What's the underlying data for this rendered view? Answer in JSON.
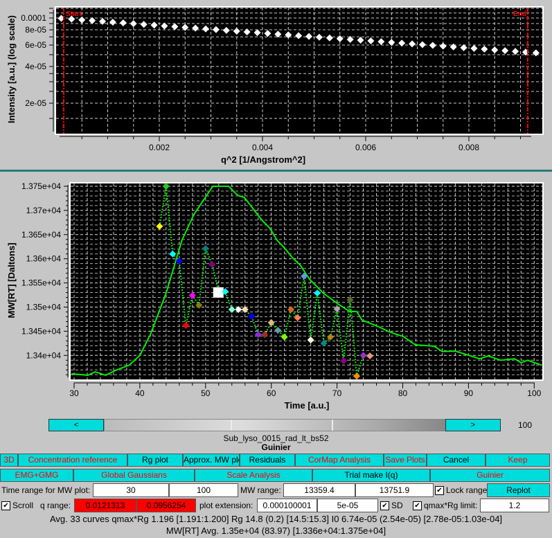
{
  "colors": {
    "button_bg": "#00dcdc",
    "alert_text": "#ff0000",
    "plot_bg": "#000000",
    "grid": "#ffffff",
    "curve": "#00ee00",
    "range_line": "#ff0000"
  },
  "chart_data": [
    {
      "type": "scatter",
      "xlabel": "q^2 [1/Angstrom^2]",
      "ylabel": "Intensity [a.u.] (log scale)",
      "y_scale": "log",
      "grid": true,
      "xlim": [
        0,
        0.00942
      ],
      "ylim": [
        1.12e-05,
        0.000122
      ],
      "x_ticks": [
        "0.002",
        "0.004",
        "0.006",
        "0.008"
      ],
      "x_tick_values": [
        0.002,
        0.004,
        0.006,
        0.008
      ],
      "y_ticks": [
        "0.0001",
        "8e-05",
        "6e-05",
        "4e-05",
        "2e-05"
      ],
      "y_tick_values": [
        0.0001,
        8e-05,
        6e-05,
        4e-05,
        2e-05
      ],
      "markers": [
        {
          "label": "Start",
          "x": 0.000148
        },
        {
          "label": "End",
          "x": 0.00914
        }
      ],
      "x": [
        0.0001,
        0.0003,
        0.0005,
        0.0007,
        0.0009,
        0.0011,
        0.0013,
        0.0015,
        0.0017,
        0.0019,
        0.0021,
        0.0023,
        0.0025,
        0.0027,
        0.0029,
        0.0031,
        0.0033,
        0.0035,
        0.0037,
        0.0039,
        0.0041,
        0.0043,
        0.0045,
        0.0047,
        0.0049,
        0.0051,
        0.0053,
        0.0055,
        0.0057,
        0.0059,
        0.0061,
        0.0063,
        0.0065,
        0.0067,
        0.0069,
        0.0071,
        0.0073,
        0.0075,
        0.0077,
        0.0079,
        0.0081,
        0.0083,
        0.0085,
        0.0087,
        0.0089,
        0.0091,
        0.0093
      ],
      "y": [
        9.93e-05,
        9.79e-05,
        9.65e-05,
        9.52e-05,
        9.38e-05,
        9.25e-05,
        9.12e-05,
        8.99e-05,
        8.86e-05,
        8.74e-05,
        8.61e-05,
        8.49e-05,
        8.37e-05,
        8.26e-05,
        8.14e-05,
        8.03e-05,
        7.91e-05,
        7.8e-05,
        7.69e-05,
        7.58e-05,
        7.47e-05,
        7.37e-05,
        7.27e-05,
        7.16e-05,
        7.06e-05,
        6.96e-05,
        6.87e-05,
        6.77e-05,
        6.67e-05,
        6.58e-05,
        6.49e-05,
        6.4e-05,
        6.31e-05,
        6.22e-05,
        6.13e-05,
        6.04e-05,
        5.96e-05,
        5.88e-05,
        5.79e-05,
        5.71e-05,
        5.63e-05,
        5.55e-05,
        5.47e-05,
        5.4e-05,
        5.32e-05,
        5.25e-05,
        5.17e-05
      ]
    },
    {
      "type": "line",
      "xlabel": "Time [a.u.]",
      "ylabel": "MW[RT] [Daltons]",
      "grid": true,
      "xlim": [
        29.5,
        101.3
      ],
      "ylim": [
        13351,
        13756
      ],
      "x_ticks": [
        "30",
        "40",
        "50",
        "60",
        "70",
        "80",
        "90",
        "100"
      ],
      "x_tick_values": [
        30,
        40,
        50,
        60,
        70,
        80,
        90,
        100
      ],
      "y_ticks": [
        "1.375e+04",
        "1.37e+04",
        "1.365e+04",
        "1.36e+04",
        "1.355e+04",
        "1.35e+04",
        "1.345e+04",
        "1.34e+04"
      ],
      "y_tick_values": [
        13750,
        13700,
        13650,
        13600,
        13550,
        13500,
        13450,
        13400
      ],
      "curve": {
        "x": [
          29.6,
          32.1,
          33.2,
          34.8,
          36.3,
          38.4,
          40.0,
          41.6,
          44.0,
          46.4,
          48.2,
          51.1,
          53.5,
          54.9,
          55.9,
          58.5,
          59.8,
          60.9,
          61.9,
          63.3,
          64.4,
          65.8,
          67.9,
          70.0,
          71.9,
          73.0,
          73.8,
          75.9,
          78.1,
          80.1,
          81.9,
          84.8,
          86.0,
          88.0,
          90.1,
          91.7,
          93.0,
          94.9,
          97.0,
          98.0,
          99.0,
          101.1
        ],
        "y": [
          13362,
          13359,
          13366,
          13359,
          13369,
          13380,
          13400,
          13443,
          13529,
          13638,
          13691,
          13750,
          13750,
          13731,
          13727,
          13681,
          13663,
          13638,
          13624,
          13601,
          13587,
          13558,
          13529,
          13508,
          13491,
          13491,
          13473,
          13462,
          13448,
          13439,
          13422,
          13419,
          13408,
          13409,
          13400,
          13393,
          13399,
          13390,
          13393,
          13385,
          13390,
          13380
        ]
      },
      "points": {
        "x": [
          43,
          44,
          45,
          46,
          47,
          48,
          49,
          50,
          51,
          52,
          53,
          54,
          55,
          56,
          57,
          58,
          59,
          60,
          61,
          62,
          63,
          64,
          65,
          66,
          67,
          68,
          69,
          70,
          71,
          72,
          73,
          74,
          75
        ],
        "y": [
          13667,
          13750,
          13610,
          13595,
          13462,
          13524,
          13504,
          13621,
          13588,
          13531,
          13532,
          13495,
          13495,
          13495,
          13481,
          13443,
          13443,
          13468,
          13452,
          13438,
          13495,
          13478,
          13564,
          13432,
          13529,
          13425,
          13438,
          13496,
          13389,
          13515,
          13357,
          13400,
          13399
        ],
        "colors": [
          "#ffff00",
          "#22cc22",
          "#00ffff",
          "#0000ff",
          "#ff0000",
          "#ff00ff",
          "#808000",
          "#008080",
          "#800080",
          "#ffffff",
          "#00ffff",
          "#7fffd4",
          "#ffffff",
          "#ffdab9",
          "#0000ff",
          "#8a2be2",
          "#a52a2a",
          "#deb887",
          "#5f9ea0",
          "#7fff00",
          "#d2691e",
          "#ff7f50",
          "#6495ed",
          "#fff8dc",
          "#00ffff",
          "#008b8b",
          "#b8860b",
          "#a9a9a9",
          "#8b008b",
          "#556b2f",
          "#ff8c00",
          "#9932cc",
          "#e9967a"
        ],
        "selected": 52
      }
    }
  ],
  "slider": {
    "prev": "<",
    "next": ">",
    "value": "100",
    "position": 0.53,
    "filename": "Sub_lyso_0015_rad_lt_bs52",
    "section": "Guinier"
  },
  "buttons_row1": [
    {
      "label": "3D",
      "red": true
    },
    {
      "label": "Concentration reference",
      "red": true
    },
    {
      "label": "Rg plot",
      "red": false
    },
    {
      "label": "Approx. MW plot",
      "red": false
    },
    {
      "label": "Residuals",
      "red": false
    },
    {
      "label": "CorMap Analysis",
      "red": true
    },
    {
      "label": "Save Plots",
      "red": true
    },
    {
      "label": "Cancel",
      "red": false
    },
    {
      "label": "Keep",
      "red": true
    }
  ],
  "buttons_row2": [
    {
      "label": "EMG+GMG",
      "red": true
    },
    {
      "label": "Global Gaussians",
      "red": true
    },
    {
      "label": "Scale Analysis",
      "red": true
    },
    {
      "label": "Trial make I(q)",
      "red": false
    },
    {
      "label": "Guinier",
      "red": true
    }
  ],
  "controls": {
    "time_range_label": "Time range for MW plot:",
    "time_min": "30",
    "time_max": "100",
    "mw_range_label": "MW range:",
    "mw_min": "13359.4",
    "mw_max": "13751.9",
    "lock_range_label": "Lock range",
    "lock_range_checked": true,
    "replot": "Replot",
    "scroll_label": "Scroll",
    "scroll_checked": true,
    "q_range_label": "q range:",
    "q_min": "0.0121313",
    "q_max": "0.0956254",
    "plot_extension_label": "plot extension:",
    "ext1": "0.000100001",
    "ext2": "5e-05",
    "sd_label": "SD",
    "sd_checked": true,
    "qmaxrg_label": "qmax*Rg limit:",
    "qmaxrg_checked": true,
    "qmaxrg_value": "1.2"
  },
  "status": {
    "line1": "Avg. 33 curves  qmax*Rg 1.196 [1.191:1.200]  Rg 14.8 (0.2) [14.5:15.3]  I0 6.74e-05 (2.54e-05) [2.78e-05:1.03e-04]",
    "line2": "MW[RT] Avg.  1.35e+04 (83.97) [1.336e+04:1.375e+04]"
  }
}
